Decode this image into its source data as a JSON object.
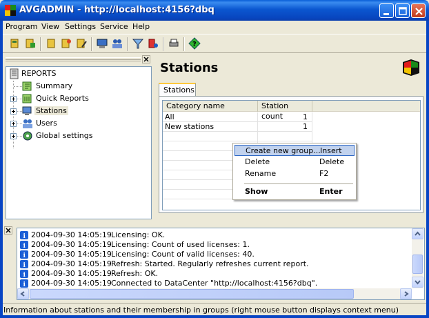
{
  "window": {
    "title": "AVGADMIN - http://localhost:4156?dbq"
  },
  "menu": [
    "Program",
    "View",
    "Settings",
    "Service",
    "Help"
  ],
  "toolbar": {
    "icons": [
      "stations-icon",
      "stations-edit-icon",
      "group-icon",
      "group-add-icon",
      "group-edit-icon",
      "network-icon",
      "users-icon",
      "filter-icon",
      "alert-icon",
      "print-icon",
      "help-icon"
    ]
  },
  "tree": {
    "root": "REPORTS",
    "items": [
      {
        "label": "Summary",
        "expandable": false
      },
      {
        "label": "Quick Reports",
        "expandable": true
      },
      {
        "label": "Stations",
        "expandable": true,
        "selected": true
      },
      {
        "label": "Users",
        "expandable": true
      },
      {
        "label": "Global settings",
        "expandable": true
      }
    ]
  },
  "main": {
    "title": "Stations",
    "tab": "Stations",
    "columns": [
      "Category name",
      "Station count"
    ],
    "rows": [
      {
        "name": "All",
        "count": "1"
      },
      {
        "name": "New stations",
        "count": "1"
      }
    ]
  },
  "context_menu": {
    "items": [
      {
        "label": "Create new group...",
        "key": "Insert",
        "highlighted": true
      },
      {
        "label": "Delete",
        "key": "Delete"
      },
      {
        "label": "Rename",
        "key": "F2"
      },
      {
        "label": "Show",
        "key": "Enter",
        "bold": true
      }
    ]
  },
  "log": [
    {
      "time": "2004-09-30 14:05:19",
      "msg": "Licensing: OK."
    },
    {
      "time": "2004-09-30 14:05:19",
      "msg": "Licensing: Count of used licenses: 1."
    },
    {
      "time": "2004-09-30 14:05:19",
      "msg": "Licensing: Count of valid licenses: 40."
    },
    {
      "time": "2004-09-30 14:05:19",
      "msg": "Refresh: Started. Regularly refreshes current report."
    },
    {
      "time": "2004-09-30 14:05:19",
      "msg": "Refresh: OK."
    },
    {
      "time": "2004-09-30 14:05:19",
      "msg": "Connected to DataCenter \"http://localhost:4156?dbq\"."
    }
  ],
  "status": "Information about stations and their membership in groups (right mouse button displays context menu)"
}
